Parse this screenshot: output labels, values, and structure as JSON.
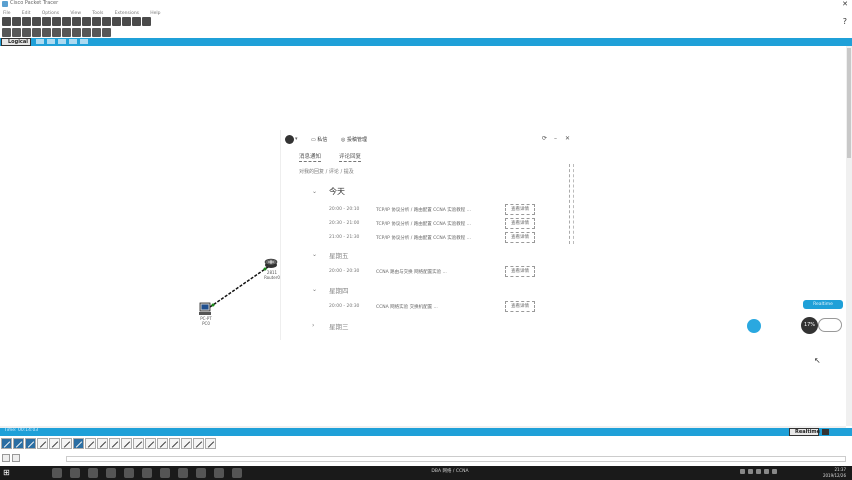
{
  "app": {
    "title": "Cisco Packet Tracer"
  },
  "menu": [
    "File",
    "Edit",
    "Options",
    "View",
    "Tools",
    "Extensions",
    "Help"
  ],
  "toolbar": {
    "help_label": "?"
  },
  "nav": {
    "logical_label": "Logical"
  },
  "devices": {
    "router": {
      "label_line1": "2811",
      "label_line2": "Router0"
    },
    "pc": {
      "label_line1": "PC-PT",
      "label_line2": "PC0"
    }
  },
  "panel": {
    "avatar_dd": "▾",
    "button1": "私信",
    "button2": "投稿管理",
    "controls": [
      "⟳",
      "–",
      "✕"
    ],
    "tabs": [
      "消息通知",
      "评论回复"
    ],
    "subline": "对我的回复 / 评论 / 提及",
    "groups": [
      {
        "title": "今天",
        "rows": [
          {
            "time": "20:00 - 20:10",
            "text": "TCP/IP 协议分析 / 路由配置 CCNA 实验教程 ...",
            "button": "查看详情"
          },
          {
            "time": "20:30 - 21:00",
            "text": "TCP/IP 协议分析 / 路由配置 CCNA 实验教程 ...",
            "button": "查看详情"
          },
          {
            "time": "21:00 - 21:30",
            "text": "TCP/IP 协议分析 / 路由配置 CCNA 实验教程 ...",
            "button": "查看详情"
          }
        ]
      },
      {
        "title": "星期五",
        "rows": [
          {
            "time": "20:00 - 20:30",
            "text": "CCNA 路由与交换 网络配置实验 ...",
            "button": "查看详情"
          }
        ]
      },
      {
        "title": "星期四",
        "rows": [
          {
            "time": "20:00 - 20:30",
            "text": "CCNA 网络实验 交换机配置 ...",
            "button": "查看详情"
          }
        ]
      },
      {
        "title": "星期三",
        "rows": []
      }
    ]
  },
  "widgets": {
    "rt_button": "Realtime",
    "gauge": "17%"
  },
  "simbar": {
    "time_label": "Time: 00:14:03",
    "realtime_label": "Realtime"
  },
  "taskbar": {
    "start": "⊞",
    "title": "DBA 网络 / CCNA",
    "clock_time": "21:37",
    "clock_date": "2019/12/26"
  },
  "colors": {
    "accent": "#1fa0d8",
    "taskbar": "#1a1a1a"
  }
}
